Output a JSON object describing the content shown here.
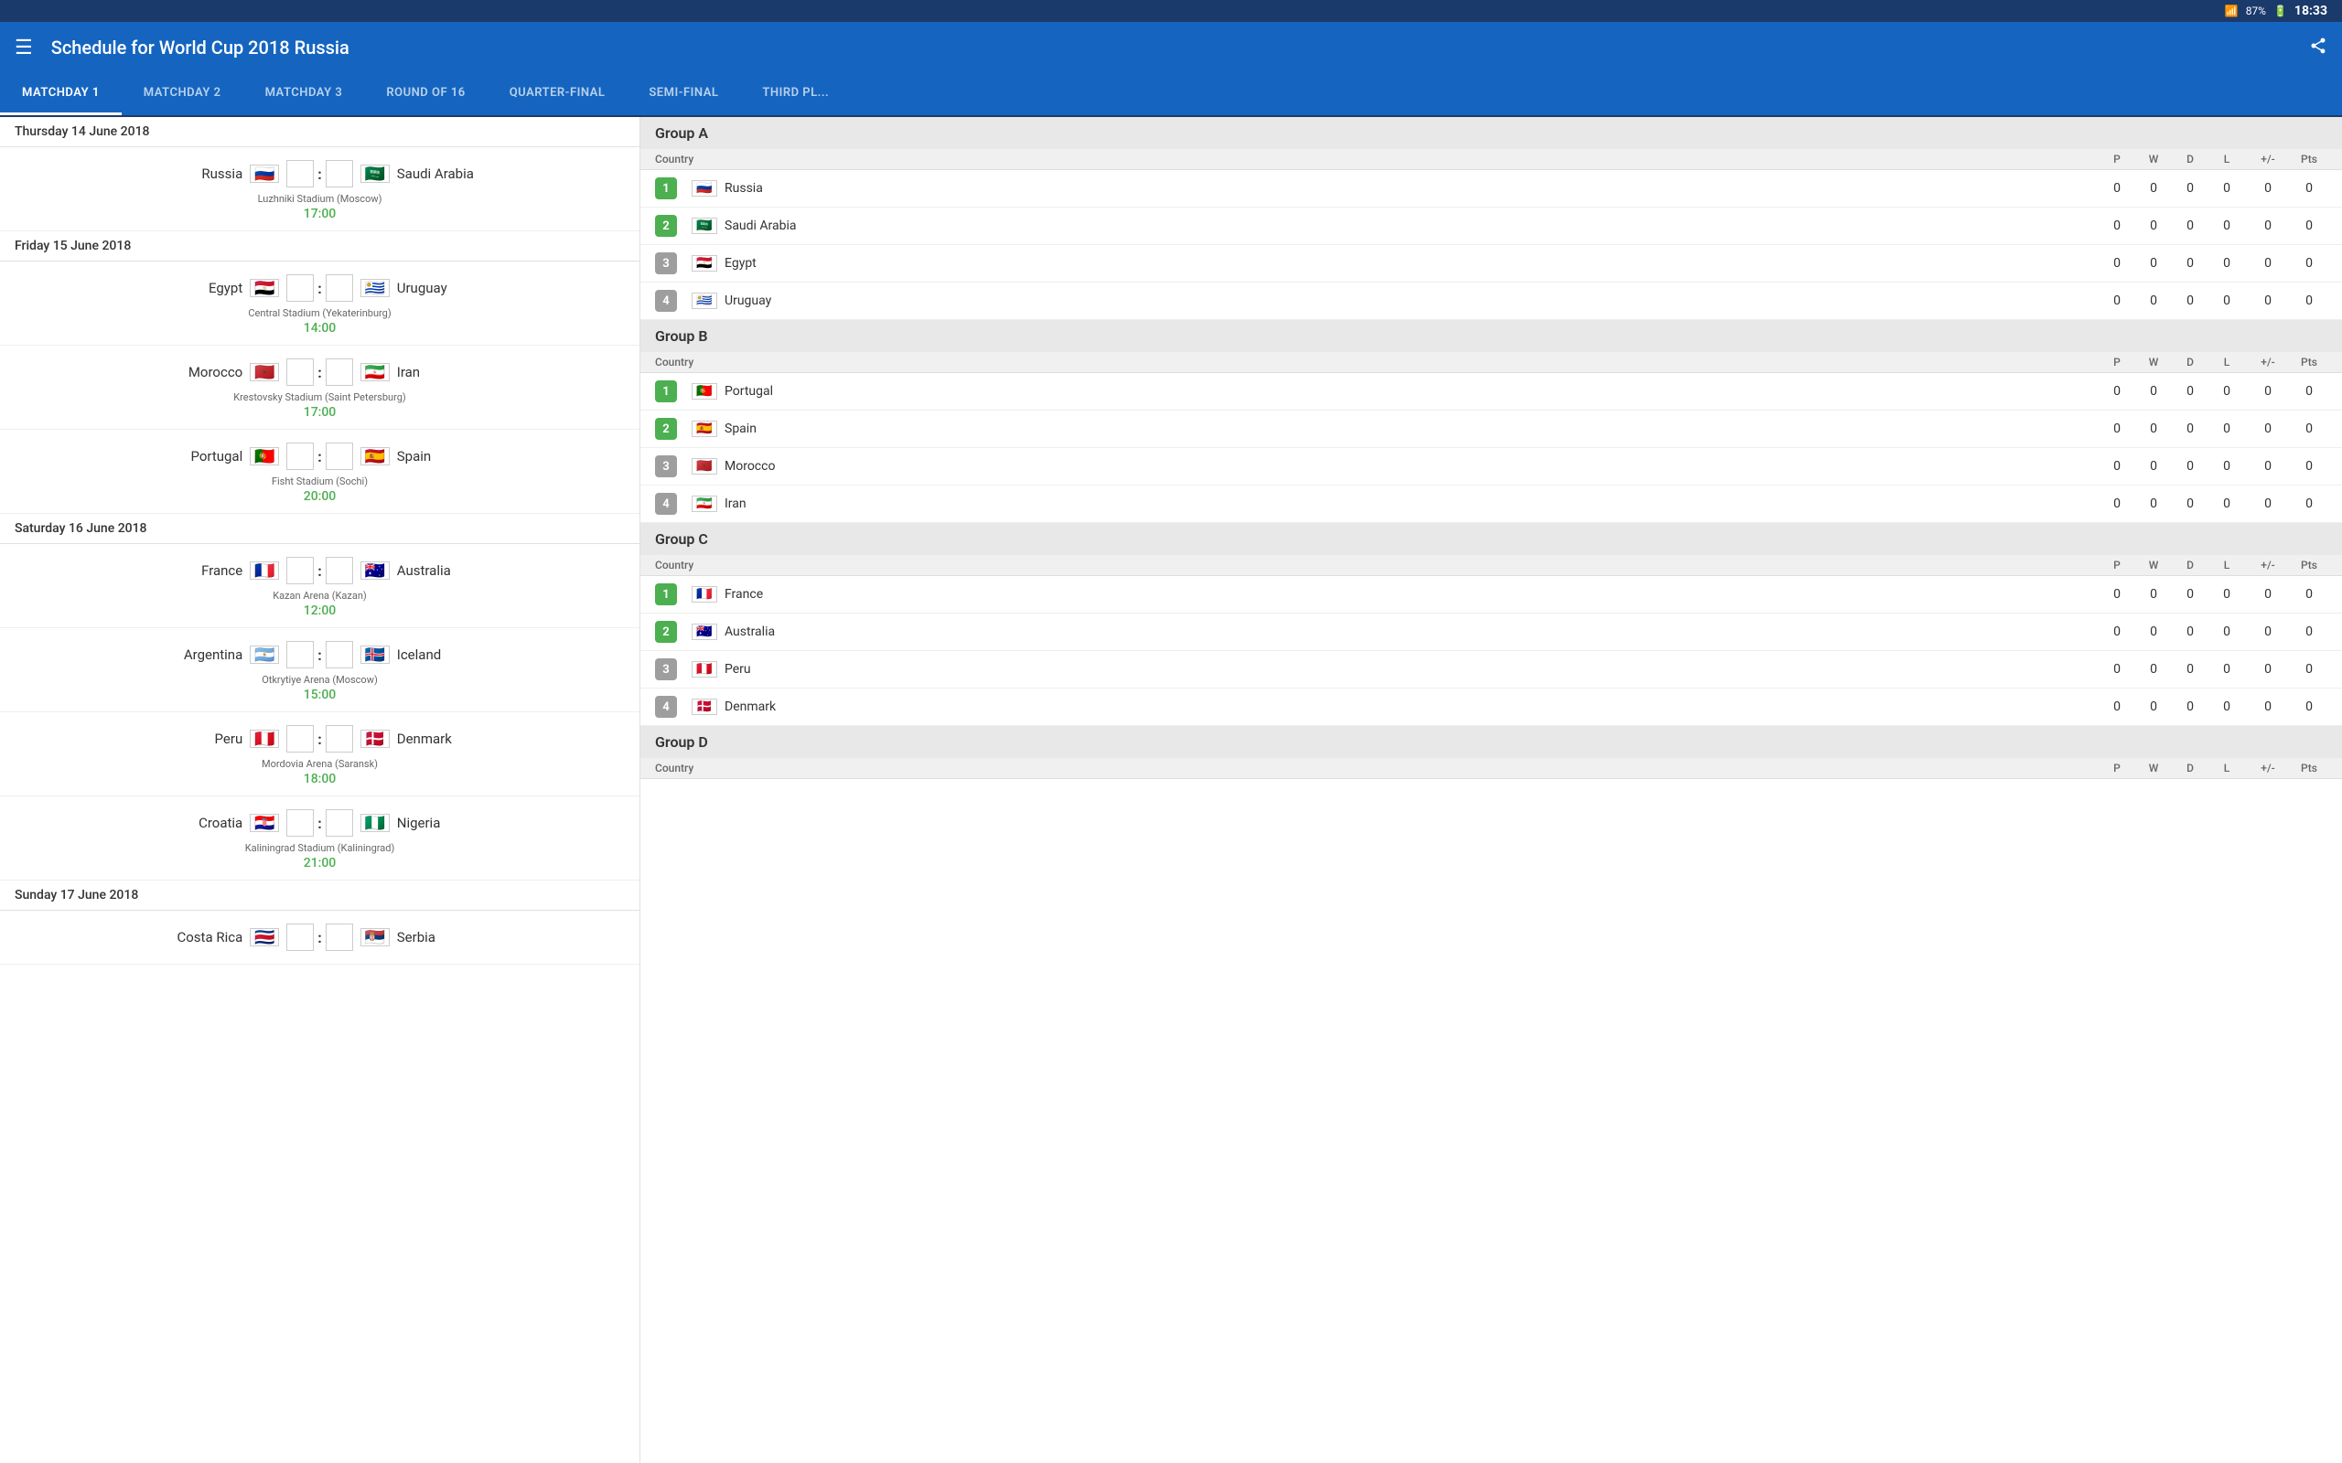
{
  "statusBar": {
    "battery": "87%",
    "time": "18:33",
    "wifi": true
  },
  "topBar": {
    "title": "Schedule for World Cup 2018 Russia"
  },
  "tabs": [
    {
      "id": "matchday1",
      "label": "MATCHDAY 1",
      "active": true
    },
    {
      "id": "matchday2",
      "label": "MATCHDAY 2",
      "active": false
    },
    {
      "id": "matchday3",
      "label": "MATCHDAY 3",
      "active": false
    },
    {
      "id": "round16",
      "label": "ROUND OF 16",
      "active": false
    },
    {
      "id": "quarter",
      "label": "QUARTER-FINAL",
      "active": false
    },
    {
      "id": "semi",
      "label": "SEMI-FINAL",
      "active": false
    },
    {
      "id": "third",
      "label": "THIRD PL...",
      "active": false
    }
  ],
  "matchDays": [
    {
      "date": "Thursday 14 June 2018",
      "matches": [
        {
          "team1": "Russia",
          "flag1": "🇷🇺",
          "team2": "Saudi Arabia",
          "flag2": "🇸🇦",
          "stadium": "Luzhniki Stadium (Moscow)",
          "time": "17:00"
        }
      ]
    },
    {
      "date": "Friday 15 June 2018",
      "matches": [
        {
          "team1": "Egypt",
          "flag1": "🇪🇬",
          "team2": "Uruguay",
          "flag2": "🇺🇾",
          "stadium": "Central Stadium (Yekaterinburg)",
          "time": "14:00"
        },
        {
          "team1": "Morocco",
          "flag1": "🇲🇦",
          "team2": "Iran",
          "flag2": "🇮🇷",
          "stadium": "Krestovsky Stadium (Saint Petersburg)",
          "time": "17:00"
        },
        {
          "team1": "Portugal",
          "flag1": "🇵🇹",
          "team2": "Spain",
          "flag2": "🇪🇸",
          "stadium": "Fisht Stadium (Sochi)",
          "time": "20:00"
        }
      ]
    },
    {
      "date": "Saturday 16 June 2018",
      "matches": [
        {
          "team1": "France",
          "flag1": "🇫🇷",
          "team2": "Australia",
          "flag2": "🇦🇺",
          "stadium": "Kazan Arena (Kazan)",
          "time": "12:00"
        },
        {
          "team1": "Argentina",
          "flag1": "🇦🇷",
          "team2": "Iceland",
          "flag2": "🇮🇸",
          "stadium": "Otkrytiye Arena (Moscow)",
          "time": "15:00"
        },
        {
          "team1": "Peru",
          "flag1": "🇵🇪",
          "team2": "Denmark",
          "flag2": "🇩🇰",
          "stadium": "Mordovia Arena (Saransk)",
          "time": "18:00"
        },
        {
          "team1": "Croatia",
          "flag1": "🇭🇷",
          "team2": "Nigeria",
          "flag2": "🇳🇬",
          "stadium": "Kaliningrad Stadium (Kaliningrad)",
          "time": "21:00"
        }
      ]
    },
    {
      "date": "Sunday 17 June 2018",
      "matches": [
        {
          "team1": "Costa Rica",
          "flag1": "🇨🇷",
          "team2": "Serbia",
          "flag2": "🇷🇸",
          "stadium": "",
          "time": ""
        }
      ]
    }
  ],
  "groups": [
    {
      "name": "Group A",
      "columns": [
        "Country",
        "P",
        "W",
        "D",
        "L",
        "+/-",
        "Pts"
      ],
      "teams": [
        {
          "rank": 1,
          "name": "Russia",
          "flag": "🇷🇺",
          "p": 0,
          "w": 0,
          "d": 0,
          "l": 0,
          "gd": 0,
          "pts": 0
        },
        {
          "rank": 2,
          "name": "Saudi Arabia",
          "flag": "🇸🇦",
          "p": 0,
          "w": 0,
          "d": 0,
          "l": 0,
          "gd": 0,
          "pts": 0
        },
        {
          "rank": 3,
          "name": "Egypt",
          "flag": "🇪🇬",
          "p": 0,
          "w": 0,
          "d": 0,
          "l": 0,
          "gd": 0,
          "pts": 0
        },
        {
          "rank": 4,
          "name": "Uruguay",
          "flag": "🇺🇾",
          "p": 0,
          "w": 0,
          "d": 0,
          "l": 0,
          "gd": 0,
          "pts": 0
        }
      ]
    },
    {
      "name": "Group B",
      "columns": [
        "Country",
        "P",
        "W",
        "D",
        "L",
        "+/-",
        "Pts"
      ],
      "teams": [
        {
          "rank": 1,
          "name": "Portugal",
          "flag": "🇵🇹",
          "p": 0,
          "w": 0,
          "d": 0,
          "l": 0,
          "gd": 0,
          "pts": 0
        },
        {
          "rank": 2,
          "name": "Spain",
          "flag": "🇪🇸",
          "p": 0,
          "w": 0,
          "d": 0,
          "l": 0,
          "gd": 0,
          "pts": 0
        },
        {
          "rank": 3,
          "name": "Morocco",
          "flag": "🇲🇦",
          "p": 0,
          "w": 0,
          "d": 0,
          "l": 0,
          "gd": 0,
          "pts": 0
        },
        {
          "rank": 4,
          "name": "Iran",
          "flag": "🇮🇷",
          "p": 0,
          "w": 0,
          "d": 0,
          "l": 0,
          "gd": 0,
          "pts": 0
        }
      ]
    },
    {
      "name": "Group C",
      "columns": [
        "Country",
        "P",
        "W",
        "D",
        "L",
        "+/-",
        "Pts"
      ],
      "teams": [
        {
          "rank": 1,
          "name": "France",
          "flag": "🇫🇷",
          "p": 0,
          "w": 0,
          "d": 0,
          "l": 0,
          "gd": 0,
          "pts": 0
        },
        {
          "rank": 2,
          "name": "Australia",
          "flag": "🇦🇺",
          "p": 0,
          "w": 0,
          "d": 0,
          "l": 0,
          "gd": 0,
          "pts": 0
        },
        {
          "rank": 3,
          "name": "Peru",
          "flag": "🇵🇪",
          "p": 0,
          "w": 0,
          "d": 0,
          "l": 0,
          "gd": 0,
          "pts": 0
        },
        {
          "rank": 4,
          "name": "Denmark",
          "flag": "🇩🇰",
          "p": 0,
          "w": 0,
          "d": 0,
          "l": 0,
          "gd": 0,
          "pts": 0
        }
      ]
    },
    {
      "name": "Group D",
      "columns": [
        "Country",
        "P",
        "W",
        "D",
        "L",
        "+/-",
        "Pts"
      ],
      "teams": []
    }
  ]
}
